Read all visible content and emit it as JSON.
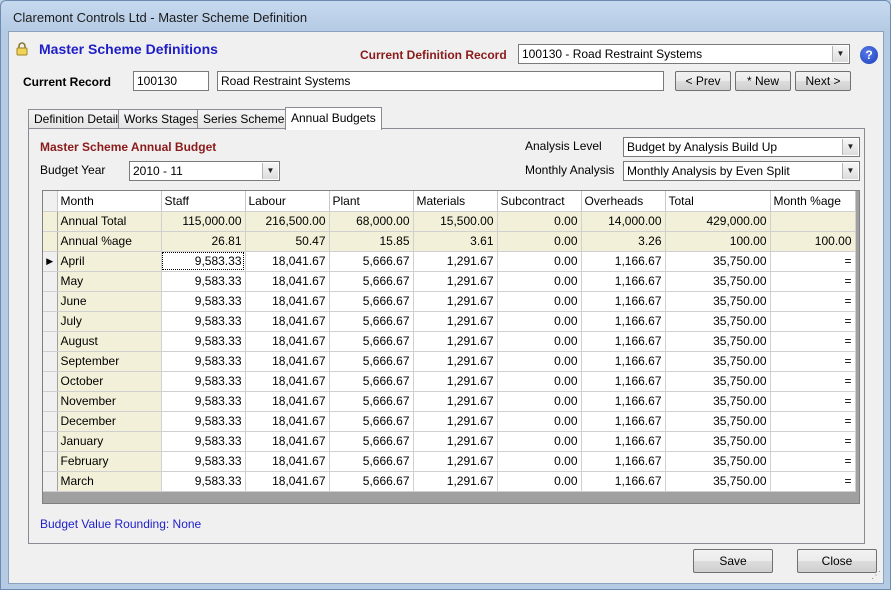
{
  "window": {
    "title": "Claremont Controls Ltd - Master Scheme Definition"
  },
  "header": {
    "title": "Master Scheme Definitions",
    "current_definition_label": "Current Definition Record",
    "current_definition_value": "100130 - Road Restraint Systems",
    "help": "?"
  },
  "record": {
    "label": "Current Record",
    "code": "100130",
    "name": "Road Restraint Systems",
    "prev": "< Prev",
    "new": "* New",
    "next": "Next >"
  },
  "tabs": [
    "Definition Details",
    "Works Stages",
    "Series Schemes",
    "Annual Budgets"
  ],
  "budget": {
    "section_title": "Master Scheme Annual Budget",
    "year_label": "Budget Year",
    "year_value": "2010 - 11",
    "analysis_level_label": "Analysis Level",
    "analysis_level_value": "Budget by Analysis Build Up",
    "monthly_analysis_label": "Monthly Analysis",
    "monthly_analysis_value": "Monthly Analysis by Even Split",
    "rounding": "Budget Value Rounding: None"
  },
  "grid": {
    "columns": [
      "Month",
      "Staff",
      "Labour",
      "Plant",
      "Materials",
      "Subcontract",
      "Overheads",
      "Total",
      "Month %age"
    ],
    "summary_rows": [
      [
        "Annual Total",
        "115,000.00",
        "216,500.00",
        "68,000.00",
        "15,500.00",
        "0.00",
        "14,000.00",
        "429,000.00",
        ""
      ],
      [
        "Annual %age",
        "26.81",
        "50.47",
        "15.85",
        "3.61",
        "0.00",
        "3.26",
        "100.00",
        "100.00"
      ]
    ],
    "current_row_marker": "▶",
    "rows": [
      [
        "April",
        "9,583.33",
        "18,041.67",
        "5,666.67",
        "1,291.67",
        "0.00",
        "1,166.67",
        "35,750.00",
        "="
      ],
      [
        "May",
        "9,583.33",
        "18,041.67",
        "5,666.67",
        "1,291.67",
        "0.00",
        "1,166.67",
        "35,750.00",
        "="
      ],
      [
        "June",
        "9,583.33",
        "18,041.67",
        "5,666.67",
        "1,291.67",
        "0.00",
        "1,166.67",
        "35,750.00",
        "="
      ],
      [
        "July",
        "9,583.33",
        "18,041.67",
        "5,666.67",
        "1,291.67",
        "0.00",
        "1,166.67",
        "35,750.00",
        "="
      ],
      [
        "August",
        "9,583.33",
        "18,041.67",
        "5,666.67",
        "1,291.67",
        "0.00",
        "1,166.67",
        "35,750.00",
        "="
      ],
      [
        "September",
        "9,583.33",
        "18,041.67",
        "5,666.67",
        "1,291.67",
        "0.00",
        "1,166.67",
        "35,750.00",
        "="
      ],
      [
        "October",
        "9,583.33",
        "18,041.67",
        "5,666.67",
        "1,291.67",
        "0.00",
        "1,166.67",
        "35,750.00",
        "="
      ],
      [
        "November",
        "9,583.33",
        "18,041.67",
        "5,666.67",
        "1,291.67",
        "0.00",
        "1,166.67",
        "35,750.00",
        "="
      ],
      [
        "December",
        "9,583.33",
        "18,041.67",
        "5,666.67",
        "1,291.67",
        "0.00",
        "1,166.67",
        "35,750.00",
        "="
      ],
      [
        "January",
        "9,583.33",
        "18,041.67",
        "5,666.67",
        "1,291.67",
        "0.00",
        "1,166.67",
        "35,750.00",
        "="
      ],
      [
        "February",
        "9,583.33",
        "18,041.67",
        "5,666.67",
        "1,291.67",
        "0.00",
        "1,166.67",
        "35,750.00",
        "="
      ],
      [
        "March",
        "9,583.33",
        "18,041.67",
        "5,666.67",
        "1,291.67",
        "0.00",
        "1,166.67",
        "35,750.00",
        "="
      ]
    ]
  },
  "footer": {
    "save": "Save",
    "close": "Close"
  },
  "colors": {
    "accent_blue": "#1e1ec8",
    "section_red": "#8b1a1a",
    "summary_bg": "#f2f0d8"
  }
}
